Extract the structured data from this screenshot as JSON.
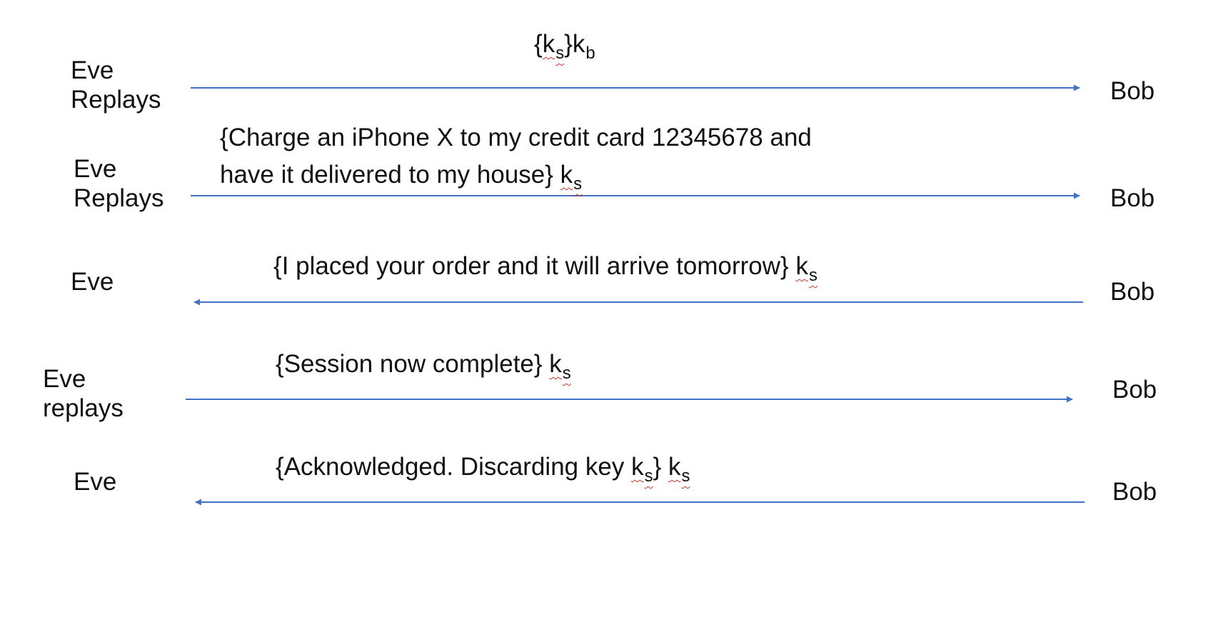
{
  "colors": {
    "arrow": "#4472C4",
    "text": "#111111",
    "squiggle": "#d93025"
  },
  "rows": [
    {
      "left": [
        "Eve",
        "Replays"
      ],
      "right": "Bob",
      "direction": "right",
      "message": [
        {
          "t": "{"
        },
        {
          "t": "k",
          "sq": true
        },
        {
          "t": "s",
          "sub": true,
          "sq": true
        },
        {
          "t": "}k"
        },
        {
          "t": "b",
          "sub": true
        }
      ]
    },
    {
      "left": [
        "Eve",
        "Replays"
      ],
      "right": "Bob",
      "direction": "right",
      "message": [
        {
          "t": "{Charge an iPhone X to my credit card 12345678 and"
        },
        {
          "br": true
        },
        {
          "t": "have it delivered to my house} "
        },
        {
          "t": "k",
          "sq": true
        },
        {
          "t": "s",
          "sub": true,
          "sq": true
        }
      ]
    },
    {
      "left": [
        "Eve"
      ],
      "right": "Bob",
      "direction": "left",
      "message": [
        {
          "t": "{I placed your order and it will arrive tomorrow} "
        },
        {
          "t": "k",
          "sq": true
        },
        {
          "t": "s",
          "sub": true,
          "sq": true
        }
      ]
    },
    {
      "left": [
        "Eve",
        "replays"
      ],
      "right": "Bob",
      "direction": "right",
      "message": [
        {
          "t": "{Session now complete} "
        },
        {
          "t": "k",
          "sq": true
        },
        {
          "t": "s",
          "sub": true,
          "sq": true
        }
      ]
    },
    {
      "left": [
        "Eve"
      ],
      "right": "Bob",
      "direction": "left",
      "message": [
        {
          "t": "{Acknowledged. Discarding key "
        },
        {
          "t": "k",
          "sq": true
        },
        {
          "t": "s",
          "sub": true,
          "sq": true
        },
        {
          "t": "} "
        },
        {
          "t": "k",
          "sq": true
        },
        {
          "t": "s",
          "sub": true,
          "sq": true
        }
      ]
    }
  ]
}
